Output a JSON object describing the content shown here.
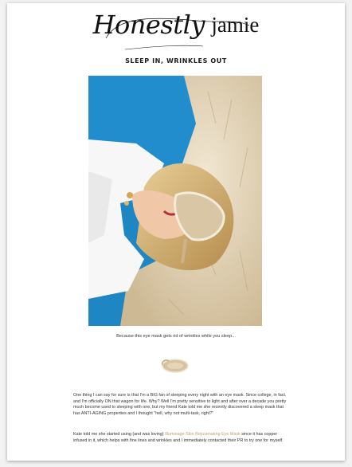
{
  "header": {
    "logo_script": "Honestly",
    "logo_plain": "jamie"
  },
  "post": {
    "title": "SLEEP IN, WRINKLES OUT",
    "hero_image": "woman-sleeping-eye-mask-photo",
    "caption": "Because this eye mask gets rid of wrinkles while you sleep...",
    "product_image": "eye-mask-product-image",
    "paragraph1": "One thing I can say for sure is that I'm a BIG fan of sleeping every night with an eye mask.  Since college, in fact, and I'm officially ON that wagon for life.  Why? Well I'm pretty sensitive to light and after over a decade you pretty much become used to sleeping with one, but my friend Kate told me she recently discovered a sleep mask that has ANTI-AGING properties and I thought \"hell, why not multi-task, right?\"",
    "paragraph2_before": "Kate told me she started using (and was loving) ",
    "paragraph2_link": "Illuminage Skin Rejuvenating Eye Mask",
    "paragraph2_after": " since it has copper infused in it, which helps with fine lines and wrinkles and I immediately contacted their PR to try one for myself."
  },
  "colors": {
    "background": "#f2f2f2",
    "page": "#ffffff",
    "link": "#c2a06a",
    "photo_blue": "#1f86c4",
    "fur": "#e6d7bf",
    "mask": "#d9c6a4"
  }
}
